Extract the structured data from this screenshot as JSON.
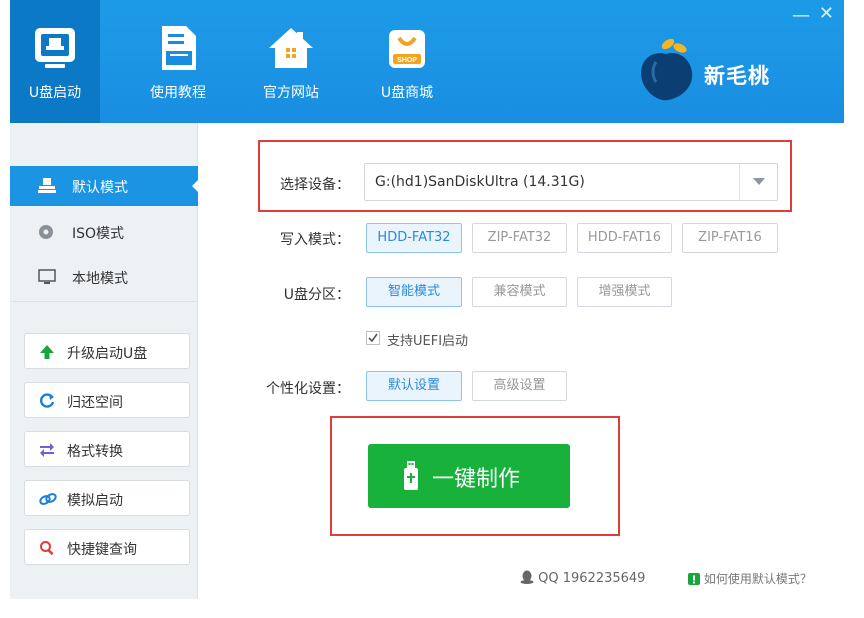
{
  "nav": {
    "items": [
      {
        "label": "U盘启动",
        "icon": "usb-boot-icon"
      },
      {
        "label": "使用教程",
        "icon": "document-icon"
      },
      {
        "label": "官方网站",
        "icon": "home-icon"
      },
      {
        "label": "U盘商城",
        "icon": "shop-bag-icon",
        "badge": "SHOP"
      }
    ]
  },
  "window": {
    "minimize": "—",
    "close": "✕"
  },
  "brand": {
    "name": "新毛桃"
  },
  "sidebar": {
    "modes": [
      {
        "label": "默认模式",
        "icon": "default-mode-icon"
      },
      {
        "label": "ISO模式",
        "icon": "disc-icon"
      },
      {
        "label": "本地模式",
        "icon": "monitor-icon"
      }
    ],
    "tools": [
      {
        "label": "升级启动U盘",
        "icon": "arrow-up-icon"
      },
      {
        "label": "归还空间",
        "icon": "refresh-icon"
      },
      {
        "label": "格式转换",
        "icon": "swap-icon"
      },
      {
        "label": "模拟启动",
        "icon": "link-icon"
      },
      {
        "label": "快捷键查询",
        "icon": "search-icon"
      }
    ]
  },
  "main": {
    "device_label": "选择设备：",
    "device_value": "G:(hd1)SanDiskUltra (14.31G)",
    "write_label": "写入模式：",
    "write_options": [
      "HDD-FAT32",
      "ZIP-FAT32",
      "HDD-FAT16",
      "ZIP-FAT16"
    ],
    "partition_label": "U盘分区：",
    "partition_options": [
      "智能模式",
      "兼容模式",
      "增强模式"
    ],
    "uefi_label": "支持UEFI启动",
    "personal_label": "个性化设置：",
    "personal_options": [
      "默认设置",
      "高级设置"
    ],
    "make_button": "一键制作"
  },
  "footer": {
    "qq": "QQ 1962235649",
    "help": "如何使用默认模式？"
  },
  "colors": {
    "header_blue": "#1b94e4",
    "active_tab": "#0c79c7",
    "green_button": "#17b13b",
    "highlight_red": "#e23b3b"
  }
}
